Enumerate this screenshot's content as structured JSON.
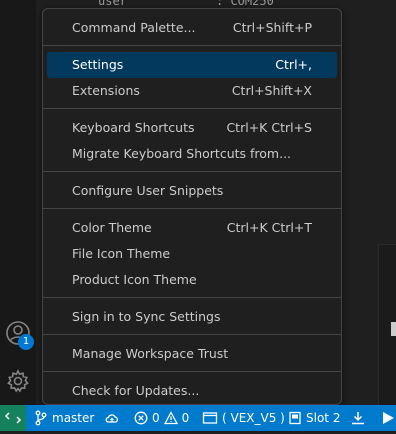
{
  "background": {
    "partial_text_left": "user",
    "partial_text_right": ": COM250"
  },
  "activity_bar": {
    "accounts_badge": "1"
  },
  "menu": {
    "items": [
      {
        "label": "Command Palette...",
        "shortcut": "Ctrl+Shift+P"
      },
      {
        "label": "Settings",
        "shortcut": "Ctrl+,"
      },
      {
        "label": "Extensions",
        "shortcut": "Ctrl+Shift+X"
      },
      {
        "label": "Keyboard Shortcuts",
        "shortcut": "Ctrl+K Ctrl+S"
      },
      {
        "label": "Migrate Keyboard Shortcuts from...",
        "shortcut": ""
      },
      {
        "label": "Configure User Snippets",
        "shortcut": ""
      },
      {
        "label": "Color Theme",
        "shortcut": "Ctrl+K Ctrl+T"
      },
      {
        "label": "File Icon Theme",
        "shortcut": ""
      },
      {
        "label": "Product Icon Theme",
        "shortcut": ""
      },
      {
        "label": "Sign in to Sync Settings",
        "shortcut": ""
      },
      {
        "label": "Manage Workspace Trust",
        "shortcut": ""
      },
      {
        "label": "Check for Updates...",
        "shortcut": ""
      }
    ],
    "highlighted": "Settings"
  },
  "status_bar": {
    "branch": "master",
    "errors": "0",
    "warnings": "0",
    "project": "( VEX_V5 )",
    "slot": "Slot 2"
  },
  "colors": {
    "status_bar": "#007acc",
    "remote_indicator": "#16825d",
    "menu_highlight": "#04395e",
    "badge": "#0078d4"
  }
}
